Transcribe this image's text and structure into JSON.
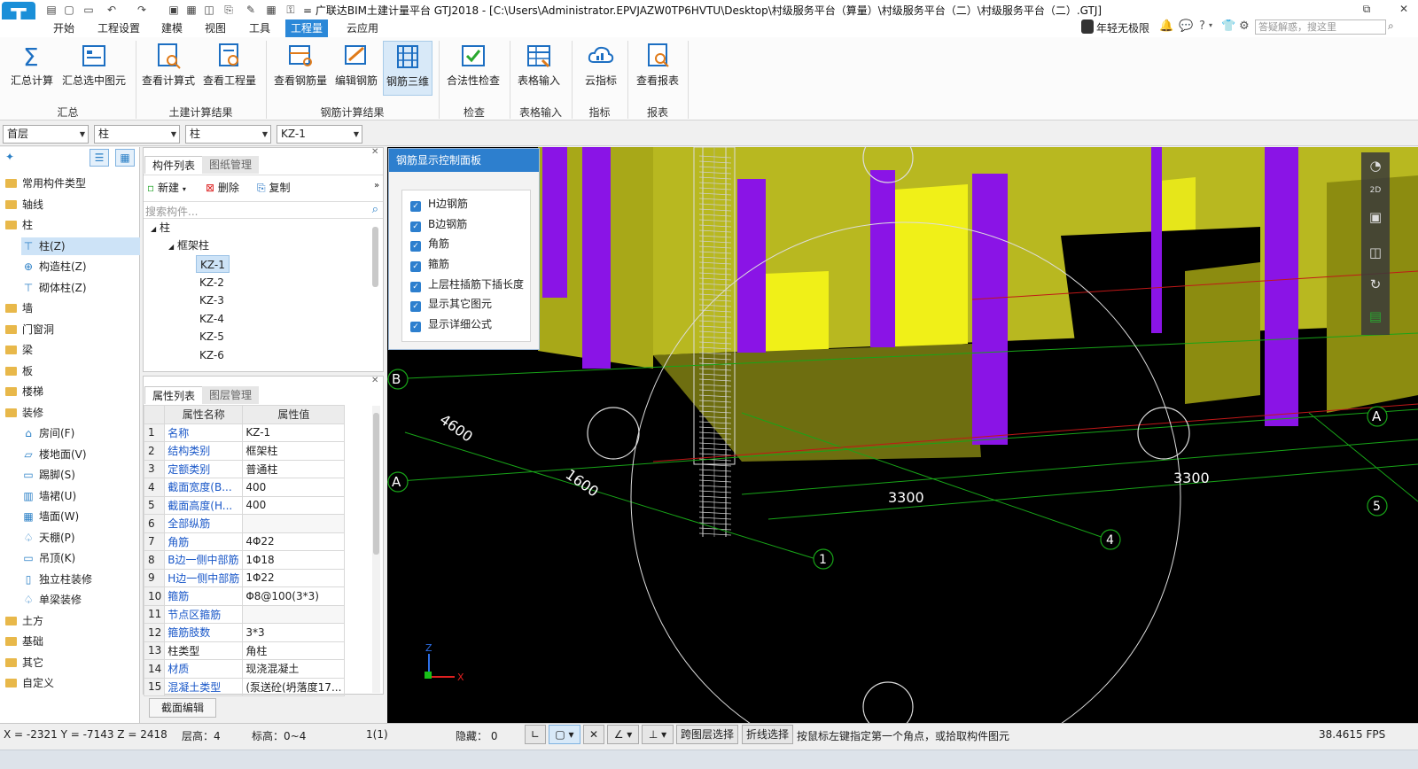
{
  "titlebar": {
    "title": "= 广联达BIM土建计量平台 GTJ2018 - [C:\\Users\\Administrator.EPVJAZW0TP6HVTU\\Desktop\\村级服务平台（算量）\\村级服务平台（二）\\村级服务平台（二）.GTJ]",
    "user": "年轻无极限",
    "search_placeholder": "答疑解惑，搜这里"
  },
  "menu": [
    "开始",
    "工程设置",
    "建模",
    "视图",
    "工具",
    "工程量",
    "云应用"
  ],
  "menu_active": "工程量",
  "ribbon": {
    "buttons": [
      "汇总计算",
      "汇总选中图元",
      "查看计算式",
      "查看工程量",
      "查看钢筋量",
      "编辑钢筋",
      "钢筋三维",
      "合法性检查",
      "表格输入",
      "云指标",
      "查看报表"
    ],
    "groups": [
      "汇总",
      "土建计算结果",
      "钢筋计算结果",
      "检查",
      "表格输入",
      "指标",
      "报表"
    ]
  },
  "selectors": [
    "首层",
    "柱",
    "柱",
    "KZ-1"
  ],
  "nav_tree": [
    {
      "label": "常用构件类型",
      "level": 0
    },
    {
      "label": "轴线",
      "level": 0
    },
    {
      "label": "柱",
      "level": 0
    },
    {
      "label": "柱(Z)",
      "level": 1,
      "selected": true
    },
    {
      "label": "构造柱(Z)",
      "level": 1
    },
    {
      "label": "砌体柱(Z)",
      "level": 1
    },
    {
      "label": "墙",
      "level": 0
    },
    {
      "label": "门窗洞",
      "level": 0
    },
    {
      "label": "梁",
      "level": 0
    },
    {
      "label": "板",
      "level": 0
    },
    {
      "label": "楼梯",
      "level": 0
    },
    {
      "label": "装修",
      "level": 0
    },
    {
      "label": "房间(F)",
      "level": 1
    },
    {
      "label": "楼地面(V)",
      "level": 1
    },
    {
      "label": "踢脚(S)",
      "level": 1
    },
    {
      "label": "墙裙(U)",
      "level": 1
    },
    {
      "label": "墙面(W)",
      "level": 1
    },
    {
      "label": "天棚(P)",
      "level": 1
    },
    {
      "label": "吊顶(K)",
      "level": 1
    },
    {
      "label": "独立柱装修",
      "level": 1
    },
    {
      "label": "单梁装修",
      "level": 1
    },
    {
      "label": "土方",
      "level": 0
    },
    {
      "label": "基础",
      "level": 0
    },
    {
      "label": "其它",
      "level": 0
    },
    {
      "label": "自定义",
      "level": 0
    }
  ],
  "component_panel": {
    "tabs": [
      "构件列表",
      "图纸管理"
    ],
    "actions": {
      "new": "新建",
      "delete": "删除",
      "copy": "复制"
    },
    "search_placeholder": "搜索构件...",
    "root": "柱",
    "group": "框架柱",
    "items": [
      "KZ-1",
      "KZ-2",
      "KZ-3",
      "KZ-4",
      "KZ-5",
      "KZ-6"
    ],
    "selected": "KZ-1"
  },
  "property_panel": {
    "tabs": [
      "属性列表",
      "图层管理"
    ],
    "headers": [
      "属性名称",
      "属性值"
    ],
    "rows": [
      {
        "n": "1",
        "name": "名称",
        "value": "KZ-1",
        "link": true
      },
      {
        "n": "2",
        "name": "结构类别",
        "value": "框架柱",
        "link": true
      },
      {
        "n": "3",
        "name": "定额类别",
        "value": "普通柱",
        "link": true
      },
      {
        "n": "4",
        "name": "截面宽度(B...",
        "value": "400",
        "link": true
      },
      {
        "n": "5",
        "name": "截面高度(H...",
        "value": "400",
        "link": true
      },
      {
        "n": "6",
        "name": "全部纵筋",
        "value": "",
        "link": true
      },
      {
        "n": "7",
        "name": "角筋",
        "value": "4Φ22",
        "link": true
      },
      {
        "n": "8",
        "name": "B边一侧中部筋",
        "value": "1Φ18",
        "link": true
      },
      {
        "n": "9",
        "name": "H边一侧中部筋",
        "value": "1Φ22",
        "link": true
      },
      {
        "n": "10",
        "name": "箍筋",
        "value": "Φ8@100(3*3)",
        "link": true
      },
      {
        "n": "11",
        "name": "节点区箍筋",
        "value": "",
        "link": true
      },
      {
        "n": "12",
        "name": "箍筋肢数",
        "value": "3*3",
        "link": true
      },
      {
        "n": "13",
        "name": "柱类型",
        "value": "角柱",
        "link": false
      },
      {
        "n": "14",
        "name": "材质",
        "value": "现浇混凝土",
        "link": true
      },
      {
        "n": "15",
        "name": "混凝土类型",
        "value": "(泵送砼(坍落度17...",
        "link": true
      }
    ],
    "section_button": "截面编辑"
  },
  "rebar_panel": {
    "title": "钢筋显示控制面板",
    "options": [
      "H边钢筋",
      "B边钢筋",
      "角筋",
      "箍筋",
      "上层柱插筋下插长度",
      "显示其它图元",
      "显示详细公式"
    ]
  },
  "viewport": {
    "dim_labels": [
      "4600",
      "1600",
      "3300",
      "3300"
    ],
    "axis_labels": [
      "B",
      "A",
      "A",
      "1",
      "4",
      "5"
    ],
    "gizmo": {
      "z": "Z",
      "x": "X"
    }
  },
  "status": {
    "coords": "X = -2321 Y = -7143 Z = 2418",
    "floor_height": "层高：4",
    "elevation": "标高：0~4",
    "count": "1(1)",
    "hidden": "隐藏：  0",
    "btn_cross_layer": "跨图层选择",
    "btn_polyline": "折线选择",
    "hint": "按鼠标左键指定第一个角点，或拾取构件图元",
    "fps": "38.4615 FPS"
  },
  "colors": {
    "accent": "#2b88d8",
    "rebar_panel_header": "#2d7fce",
    "column_purple": "#8a14e6",
    "wall_yellow": "#e6e61a",
    "slab_green": "#18e018"
  }
}
